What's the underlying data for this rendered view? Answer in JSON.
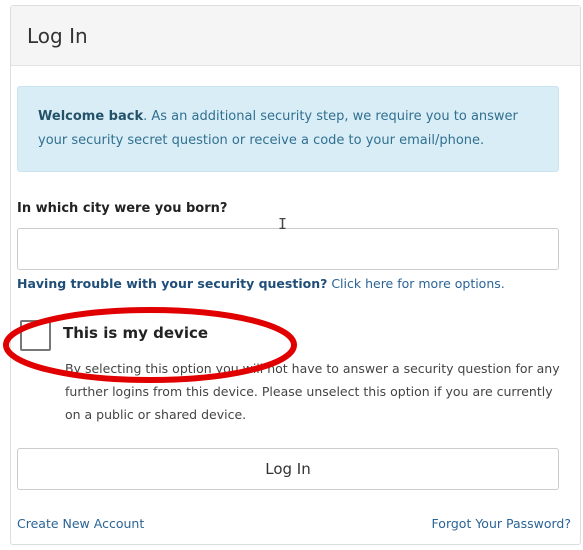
{
  "panel": {
    "title": "Log In"
  },
  "alert": {
    "bold_text": "Welcome back",
    "text": ". As an additional security step, we require you to answer your security secret question or receive a code to your email/phone."
  },
  "security_question": {
    "label": "In which city were you born?",
    "value": ""
  },
  "trouble": {
    "bold_text": "Having trouble with your security question?",
    "link_text": " Click here for more options."
  },
  "device": {
    "label": "This is my device",
    "checked": false,
    "description": "By selecting this option you will not have to answer a security question for any further logins from this device. Please unselect this option if you are currently on a public or shared device."
  },
  "actions": {
    "login_label": "Log In",
    "create_account": "Create New Account",
    "forgot_password": "Forgot Your Password?"
  },
  "annotation": {
    "highlight_color": "#e00000"
  },
  "colors": {
    "alert_bg": "#d9edf7",
    "link": "#2a6496"
  }
}
